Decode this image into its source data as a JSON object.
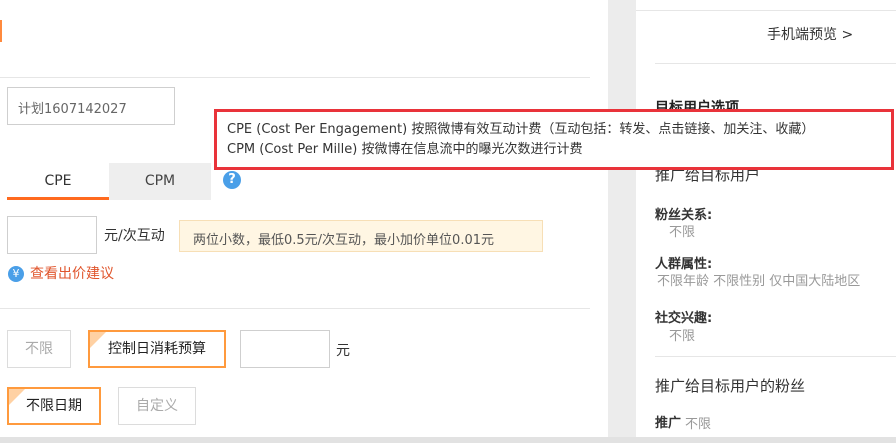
{
  "plan": {
    "name_value": "计划1607142027"
  },
  "billing": {
    "tabs": [
      {
        "label": "CPE"
      },
      {
        "label": "CPM"
      }
    ],
    "help_icon": "?",
    "unit": "元/次互动",
    "hint": "两位小数，最低0.5元/次互动，最小加价单位0.01元",
    "suggest_icon": "¥",
    "suggest_label": "查看出价建议"
  },
  "budget": {
    "unlimited_label": "不限",
    "control_label": "控制日消耗预算",
    "unit": "元"
  },
  "schedule": {
    "unlimited_label": "不限日期",
    "custom_label": "自定义"
  },
  "tooltip": {
    "line1": "CPE (Cost Per Engagement) 按照微博有效互动计费（互动包括：转发、点击链接、加关注、收藏）",
    "line2": "CPM (Cost Per Mille) 按微博在信息流中的曝光次数进行计费"
  },
  "sidebar": {
    "preview_link": "手机端预览 >",
    "target_title": "目标用户选项",
    "promote_to_users": "推广给目标用户",
    "fan_relation_label": "粉丝关系:",
    "fan_relation_value": "不限",
    "demographic_label": "人群属性:",
    "demographic_value": "不限年龄  不限性别  仅中国大陆地区",
    "social_label": "社交兴趣:",
    "social_value": "不限",
    "promote_to_fans": "推广给目标用户的粉丝",
    "promote_label": "推广",
    "promote_value": "不限"
  },
  "colors": {
    "accent": "#ff9a3d",
    "tab_underline": "#ff6a1f",
    "link": "#e0552c",
    "tooltip_border": "#e9333a",
    "info_blue": "#4a9fe8"
  }
}
